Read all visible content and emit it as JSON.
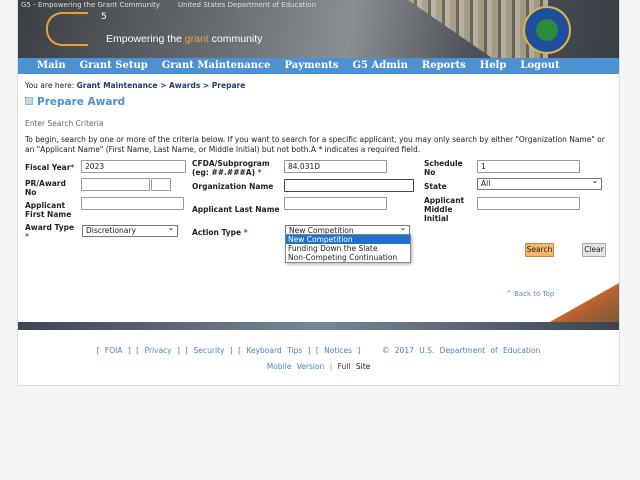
{
  "banner": {
    "alt_g5": "G5 - Empowering the Grant Community",
    "alt_ed": "United States Department of Education",
    "logo_sup": "5",
    "tagline_pre": "Empowering the ",
    "tagline_accent": "grant",
    "tagline_post": " community"
  },
  "nav": [
    "Main",
    "Grant Setup",
    "Grant Maintenance",
    "Payments",
    "G5 Admin",
    "Reports",
    "Help",
    "Logout"
  ],
  "breadcrumb": {
    "prefix": "You are here: ",
    "path": "Grant Maintenance > Awards > Prepare"
  },
  "page_title": "Prepare Award",
  "section": "Enter Search Criteria",
  "intro": "To begin, search by one or more of the criteria below. If you want to search for a specific applicant, you may only search by either \"Organization Name\" or an \"Applicant Name\" (First Name, Last Name, or Middle Initial) but not both.A * indicates a required field.",
  "form": {
    "fiscal_year": {
      "label": "Fiscal Year",
      "value": "2023"
    },
    "cfda": {
      "label": "CFDA/Subprogram (eg: ##.###A)",
      "value": "84.031D"
    },
    "schedule": {
      "label": "Schedule No",
      "value": "1"
    },
    "pr_award": {
      "label": "PR/Award No",
      "value": "",
      "suffix": ""
    },
    "org_name": {
      "label": "Organization Name",
      "value": ""
    },
    "state": {
      "label": "State",
      "value": "All"
    },
    "first_name": {
      "label": "Applicant First Name",
      "value": ""
    },
    "last_name": {
      "label": "Applicant Last Name",
      "value": ""
    },
    "middle": {
      "label": "Applicant Middle Initial",
      "value": ""
    },
    "award_type": {
      "label": "Award Type",
      "value": "Discretionary"
    },
    "action_type": {
      "label": "Action Type",
      "value": "New Competition",
      "options": [
        "New Competition",
        "Funding Down the Slate",
        "Non-Competing Continuation"
      ]
    },
    "required": "*"
  },
  "buttons": {
    "search": "Search",
    "clear": "Clear"
  },
  "back_to_top": "^ Back to Top",
  "footer": {
    "links": "[ FOIA ] [ Privacy ] [ Security ] [ Keyboard Tips ] [ Notices ]",
    "copyright": "© 2017 U.S. Department of Education",
    "mobile": "Mobile Version",
    "sep": "|",
    "full": "Full",
    "site": "Site"
  }
}
